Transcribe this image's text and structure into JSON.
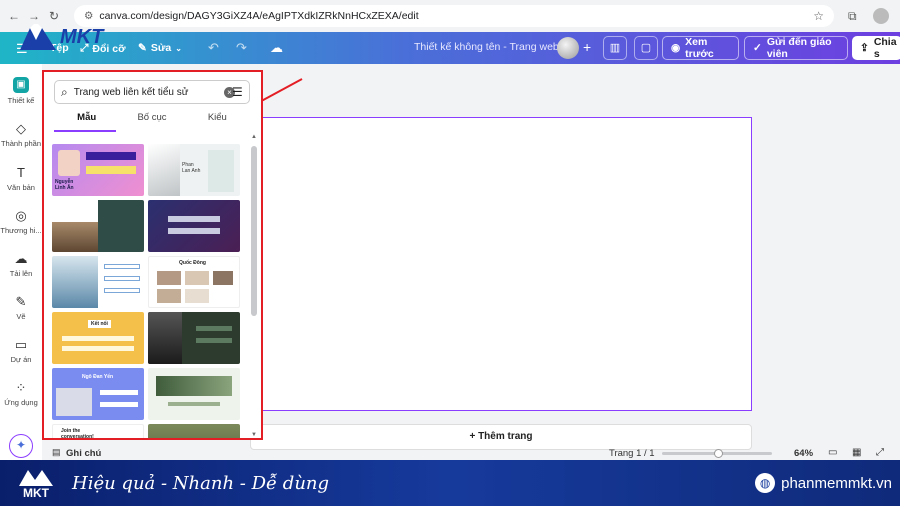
{
  "browser": {
    "url": "canva.com/design/DAGY3GiXZ4A/eAgIPTXdkIZRkNnHCxZEXA/edit"
  },
  "toolbar": {
    "menu_a": "Tệp",
    "menu_b": "Đổi cỡ",
    "edit_label": "Sửa",
    "doc_title": "Thiết kế không tên - Trang web",
    "preview_label": "Xem trước",
    "send_teacher_label": "Gửi đến giáo viên",
    "share_label": "Chia s"
  },
  "sidebar": {
    "items": [
      {
        "label": "Thiết kế"
      },
      {
        "label": "Thành phần"
      },
      {
        "label": "Văn bản"
      },
      {
        "label": "Thương hi..."
      },
      {
        "label": "Tải lên"
      },
      {
        "label": "Vẽ"
      },
      {
        "label": "Dự án"
      },
      {
        "label": "Ứng dụng"
      }
    ]
  },
  "panel": {
    "search_value": "Trang web liên kết tiểu sử",
    "tabs": [
      {
        "label": "Mẫu"
      },
      {
        "label": "Bố cục"
      },
      {
        "label": "Kiểu"
      }
    ],
    "templates": [
      {
        "text": "Nguyễn Linh Ân"
      },
      {
        "text": "Phan Lan Anh"
      },
      {
        "text": ""
      },
      {
        "text": ""
      },
      {
        "text": ""
      },
      {
        "text": "Quốc Đông"
      },
      {
        "text": "Kết nối"
      },
      {
        "text": ""
      },
      {
        "text": "Ngô Đan Yến"
      },
      {
        "text": ""
      },
      {
        "text": "Join the conversation!"
      },
      {
        "text": ""
      }
    ]
  },
  "canvas": {
    "add_page_label": "+ Thêm trang"
  },
  "status": {
    "notes_label": "Ghi chú",
    "page_label": "Trang 1 / 1",
    "zoom": "64%"
  },
  "banner": {
    "logo": "MKT",
    "slogan": "Hiệu quả - Nhanh  - Dễ dùng",
    "site": "phanmemmkt.vn"
  },
  "watermark": {
    "logo": "MKT"
  },
  "colors": {
    "accent": "#8b3dff",
    "highlight": "#e31e24",
    "banner": "#0f2a7a"
  }
}
